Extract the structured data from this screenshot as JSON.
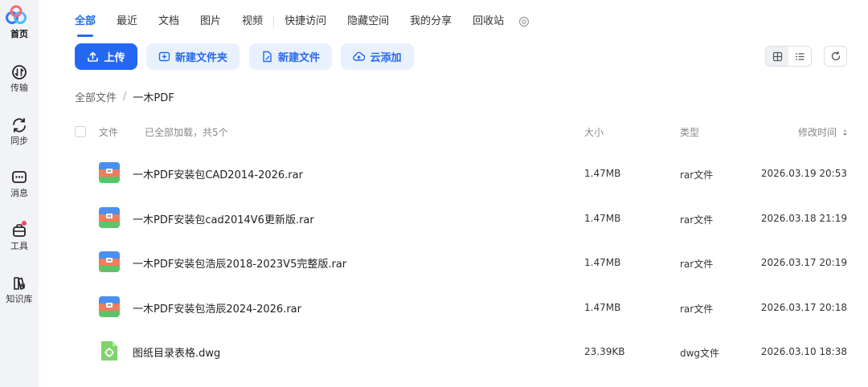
{
  "sidebar": {
    "items": [
      {
        "label": "首页",
        "icon": "home-logo-icon"
      },
      {
        "label": "传输",
        "icon": "transfer-icon"
      },
      {
        "label": "同步",
        "icon": "sync-icon"
      },
      {
        "label": "消息",
        "icon": "message-icon"
      },
      {
        "label": "工具",
        "icon": "tools-icon"
      },
      {
        "label": "知识库",
        "icon": "knowledge-base-icon"
      }
    ]
  },
  "tabs": [
    "全部",
    "最近",
    "文档",
    "图片",
    "视频",
    "快捷访问",
    "隐藏空间",
    "我的分享",
    "回收站"
  ],
  "toolbar": {
    "upload": "上传",
    "new_folder": "新建文件夹",
    "new_file": "新建文件",
    "cloud_add": "云添加"
  },
  "breadcrumb": {
    "root": "全部文件",
    "separator": "/",
    "current": "一木PDF"
  },
  "table": {
    "col_file": "文件",
    "loaded_status": "已全部加载，共5个",
    "col_size": "大小",
    "col_type": "类型",
    "col_modified": "修改时间",
    "rows": [
      {
        "name": "一木PDF安装包CAD2014-2026.rar",
        "size": "1.47MB",
        "type": "rar文件",
        "modified": "2026.03.19 20:53",
        "icon": "rar-archive-icon"
      },
      {
        "name": "一木PDF安装包cad2014V6更新版.rar",
        "size": "1.47MB",
        "type": "rar文件",
        "modified": "2026.03.18 21:19",
        "icon": "rar-archive-icon"
      },
      {
        "name": "一木PDF安装包浩辰2018-2023V5完整版.rar",
        "size": "1.47MB",
        "type": "rar文件",
        "modified": "2026.03.17 20:19",
        "icon": "rar-archive-icon"
      },
      {
        "name": "一木PDF安装包浩辰2024-2026.rar",
        "size": "1.47MB",
        "type": "rar文件",
        "modified": "2026.03.17 20:18",
        "icon": "rar-archive-icon"
      },
      {
        "name": "图纸目录表格.dwg",
        "size": "23.39KB",
        "type": "dwg文件",
        "modified": "2026.03.10 18:38",
        "icon": "dwg-file-icon"
      }
    ]
  },
  "colors": {
    "accent": "#2468f2",
    "accent_light": "#eaf1fe",
    "sidebar_bg": "#f2f3f7",
    "notify_dot": "#f5465d"
  }
}
